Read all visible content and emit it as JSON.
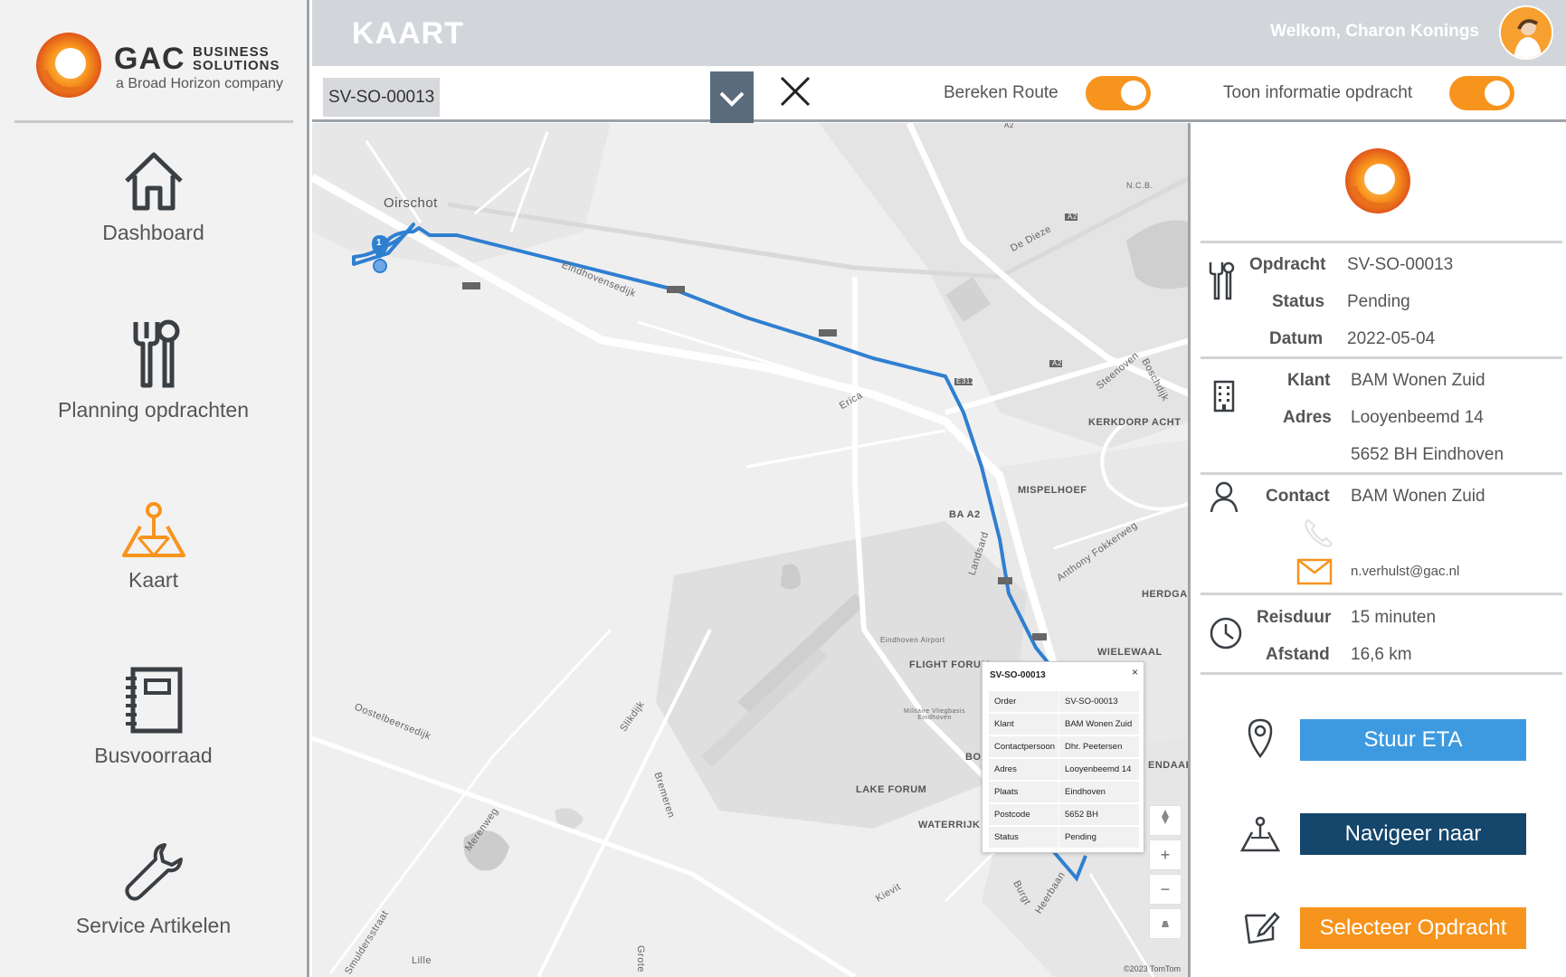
{
  "brand": {
    "logo_main": "GAC",
    "logo_business": "BUSINESS",
    "logo_solutions": "SOLUTIONS",
    "logo_tagline": "a Broad Horizon company"
  },
  "colors": {
    "accent_orange": "#f7941d",
    "eta_blue": "#3d9ae0",
    "navy": "#15466c",
    "route_blue": "#2f7fd1"
  },
  "sidebar": {
    "items": [
      {
        "label": "Dashboard",
        "icon": "home-icon"
      },
      {
        "label": "Planning opdrachten",
        "icon": "tools-icon"
      },
      {
        "label": "Kaart",
        "icon": "map-pin-icon"
      },
      {
        "label": "Busvoorraad",
        "icon": "notebook-icon"
      },
      {
        "label": "Service Artikelen",
        "icon": "wrench-icon"
      }
    ],
    "active": "Kaart"
  },
  "header": {
    "title": "KAART",
    "welcome": "Welkom, Charon Konings"
  },
  "toolbar": {
    "selected_order": "SV-SO-00013",
    "bereken_route_label": "Bereken Route",
    "bereken_route_on": true,
    "toon_info_label": "Toon informatie opdracht",
    "toon_info_on": true
  },
  "map": {
    "labels": {
      "oirschot": "Oirschot",
      "eindhovensedijk": "Eindhovensedijk",
      "erica": "Erica",
      "de_dieze": "De Dieze",
      "steenoven": "Steenoven",
      "boschdijk": "Boschdijk",
      "kerkdorp_acht": "KERKDORP ACHT",
      "mispelhoef": "MISPELHOEF",
      "ba_a2": "BA A2",
      "landsard": "Landsard",
      "anthony_fokkerweg": "Anthony Fokkerweg",
      "herdgang": "HERDGAN",
      "wielewaal": "WIELEWAAL",
      "eindhoven_airport": "Eindhoven Airport",
      "flight_forum": "FLIGHT FORUM",
      "militaire_vliegbasis": "Militaire Vliegbasis Eindhoven",
      "lake_forum": "LAKE FORUM",
      "waterrijk": "WATERRIJK",
      "oostelbeersedijk": "Oostelbeersedijk",
      "slikdijk": "Slikdijk",
      "bremeren": "Bremeren",
      "merenweg": "Merenweg",
      "smuldersstraat": "Smuldersstraat",
      "lille": "Lille",
      "grote": "Grote",
      "kievit": "Kievit",
      "burgt": "Burgt",
      "heerbaan": "Heerbaan",
      "endaal": "ENDAAL",
      "bo": "BO",
      "ncb": "N.C.B.",
      "a2_1": "A2",
      "a2_2": "A2",
      "a2_3": "A2",
      "e312": "E312",
      "marker_number": "1"
    },
    "copyright": "©2023 TomTom",
    "popup": {
      "title": "SV-SO-00013",
      "close": "×",
      "rows": [
        {
          "k": "Order",
          "v": "SV-SO-00013"
        },
        {
          "k": "Klant",
          "v": "BAM Wonen Zuid"
        },
        {
          "k": "Contactpersoon",
          "v": "Dhr. Peetersen"
        },
        {
          "k": "Adres",
          "v": "Looyenbeemd 14"
        },
        {
          "k": "Plaats",
          "v": "Eindhoven"
        },
        {
          "k": "Postcode",
          "v": "5652 BH"
        },
        {
          "k": "Status",
          "v": "Pending"
        }
      ]
    },
    "controls": {
      "zoom_in": "+",
      "zoom_out": "−"
    }
  },
  "panel": {
    "opdracht": {
      "k_opdracht": "Opdracht",
      "v_opdracht": "SV-SO-00013",
      "k_status": "Status",
      "v_status": "Pending",
      "k_datum": "Datum",
      "v_datum": "2022-05-04"
    },
    "klant": {
      "k_klant": "Klant",
      "v_klant": "BAM Wonen Zuid",
      "k_adres": "Adres",
      "v_adres1": "Looyenbeemd 14",
      "v_adres2": "5652 BH Eindhoven"
    },
    "contact": {
      "k_contact": "Contact",
      "v_contact": "BAM Wonen Zuid",
      "email": "n.verhulst@gac.nl"
    },
    "reis": {
      "k_reisduur": "Reisduur",
      "v_reisduur": "15 minuten",
      "k_afstand": "Afstand",
      "v_afstand": "16,6 km"
    },
    "buttons": {
      "eta": "Stuur ETA",
      "nav": "Navigeer naar",
      "select": "Selecteer Opdracht"
    }
  }
}
